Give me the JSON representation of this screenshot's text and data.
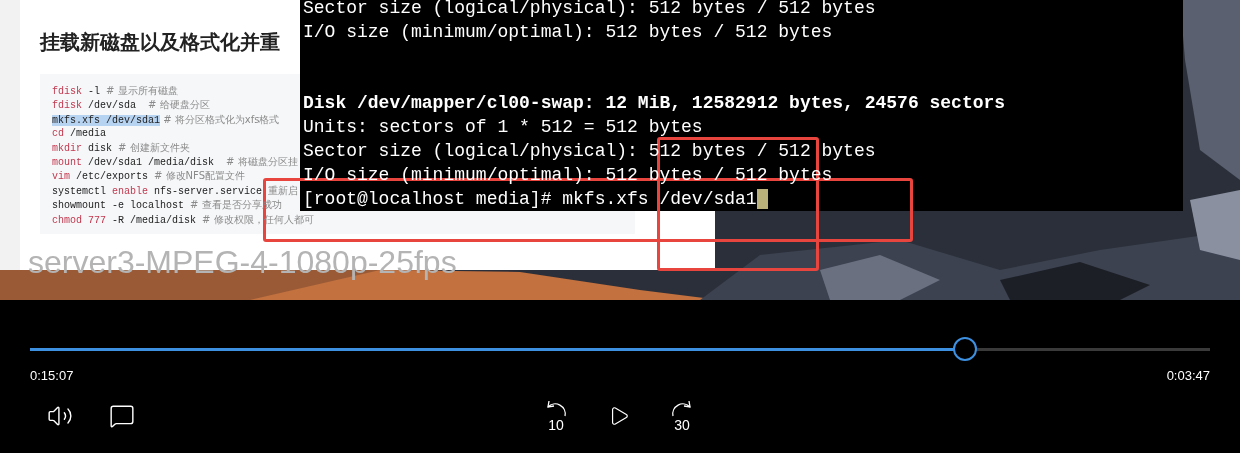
{
  "video": {
    "document": {
      "heading": "挂载新磁盘以及格式化并重",
      "code_lines": [
        {
          "parts": [
            {
              "kind": "keyword",
              "text": "fdisk"
            },
            {
              "kind": "plain",
              "text": " -l "
            },
            {
              "kind": "comment",
              "text": "# 显示所有磁盘"
            }
          ]
        },
        {
          "parts": [
            {
              "kind": "keyword",
              "text": "fdisk"
            },
            {
              "kind": "plain",
              "text": " /dev/sda  "
            },
            {
              "kind": "comment",
              "text": "# 给硬盘分区"
            }
          ]
        },
        {
          "parts": [
            {
              "kind": "selected",
              "text": "mkfs.xfs /dev/sda1"
            },
            {
              "kind": "comment",
              "text": " # 将分区格式化为xfs格式"
            }
          ]
        },
        {
          "parts": [
            {
              "kind": "keyword",
              "text": "cd"
            },
            {
              "kind": "plain",
              "text": " /media"
            }
          ]
        },
        {
          "parts": [
            {
              "kind": "keyword",
              "text": "mkdir"
            },
            {
              "kind": "plain",
              "text": " disk "
            },
            {
              "kind": "comment",
              "text": "# 创建新文件夹"
            }
          ]
        },
        {
          "parts": [
            {
              "kind": "keyword",
              "text": "mount"
            },
            {
              "kind": "plain",
              "text": " /dev/sda1 /media/disk  "
            },
            {
              "kind": "comment",
              "text": "# 将磁盘分区挂"
            }
          ]
        },
        {
          "parts": [
            {
              "kind": "keyword",
              "text": "vim"
            },
            {
              "kind": "plain",
              "text": " /etc/exports "
            },
            {
              "kind": "comment",
              "text": "# 修改NFS配置文件"
            }
          ]
        },
        {
          "parts": [
            {
              "kind": "plain",
              "text": "systemctl "
            },
            {
              "kind": "keyword",
              "text": "enable"
            },
            {
              "kind": "plain",
              "text": " nfs-server.service "
            },
            {
              "kind": "comment",
              "text": "重新启"
            }
          ]
        },
        {
          "parts": [
            {
              "kind": "plain",
              "text": "showmount -e localhost "
            },
            {
              "kind": "comment",
              "text": "# 查看是否分享成功"
            }
          ]
        },
        {
          "parts": [
            {
              "kind": "keyword",
              "text": "chmod 777"
            },
            {
              "kind": "plain",
              "text": " -R /media/disk "
            },
            {
              "kind": "comment",
              "text": "# 修改权限，任何人都可"
            }
          ]
        }
      ]
    },
    "terminal": {
      "lines": [
        {
          "kind": "normal",
          "text": "Sector size (logical/physical): 512 bytes / 512 bytes"
        },
        {
          "kind": "normal",
          "text": "I/O size (minimum/optimal): 512 bytes / 512 bytes"
        },
        {
          "kind": "blank"
        },
        {
          "kind": "blank"
        },
        {
          "kind": "bold",
          "text": "Disk /dev/mapper/cl00-swap: 12 MiB, 12582912 bytes, 24576 sectors"
        },
        {
          "kind": "normal",
          "text": "Units: sectors of 1 * 512 = 512 bytes"
        },
        {
          "kind": "normal",
          "text": "Sector size (logical/physical): 512 bytes / 512 bytes"
        },
        {
          "kind": "normal",
          "text": "I/O size (minimum/optimal): 512 bytes / 512 bytes"
        },
        {
          "kind": "prompt",
          "text": "[root@localhost media]# mkfs.xfs /dev/sda1"
        }
      ]
    },
    "title_overlay": "server3-MPEG-4-1080p-25fps"
  },
  "player": {
    "progress": {
      "level": 0.792
    },
    "elapsed": "0:15:07",
    "remaining": "0:03:47",
    "controls": [
      {
        "kind": "volume"
      },
      {
        "kind": "captions"
      },
      {
        "kind": "rewind",
        "label": "10"
      },
      {
        "kind": "play"
      },
      {
        "kind": "forward",
        "label": "30"
      }
    ]
  }
}
